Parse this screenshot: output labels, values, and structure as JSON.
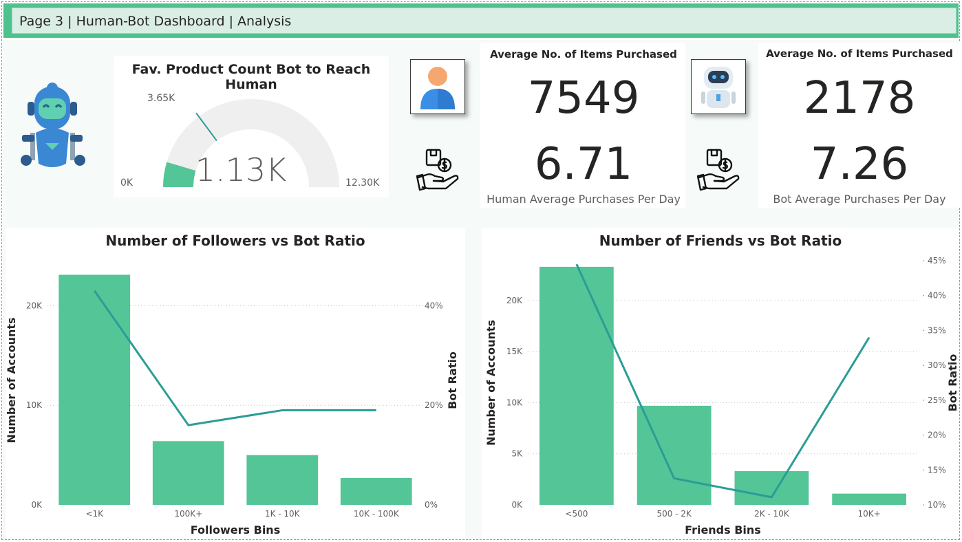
{
  "page": {
    "title": "Page 3 | Human-Bot Dashboard | Analysis",
    "colors": {
      "accent": "#4ec28e",
      "bar": "#54c596",
      "line": "#2a9d96",
      "title_bg": "#daeee6"
    }
  },
  "gauge": {
    "title": "Fav. Product Count Bot to Reach Human",
    "value_label": "1.13K",
    "min_label": "0K",
    "max_label": "12.30K",
    "target_label": "3.65K",
    "value": 1130,
    "min": 0,
    "max": 12300,
    "target": 3650
  },
  "icons": {
    "robot_tile": "robot-icon",
    "human": "person-icon",
    "bot": "bot-face-icon",
    "purchase": "hand-money-box-icon"
  },
  "human_kpi": {
    "top_label": "Average No. of Items Purchased",
    "items_value": "7549",
    "purchases_value": "6.71",
    "purchases_label": "Human Average Purchases Per Day"
  },
  "bot_kpi": {
    "top_label": "Average No. of Items Purchased",
    "items_value": "2178",
    "purchases_value": "7.26",
    "purchases_label": "Bot Average Purchases Per Day"
  },
  "chart_data": [
    {
      "type": "bar",
      "title": "Number of Followers vs Bot Ratio",
      "xlabel": "Followers Bins",
      "ylabel": "Number of Accounts",
      "y2label": "Bot Ratio",
      "categories": [
        "<1K",
        "100K+",
        "1K - 10K",
        "10K - 100K"
      ],
      "series": [
        {
          "name": "Number of Accounts",
          "kind": "bar",
          "values": [
            23100,
            6400,
            5000,
            2700
          ]
        },
        {
          "name": "Bot Ratio",
          "kind": "line",
          "axis": "y2",
          "values": [
            0.43,
            0.16,
            0.19,
            0.19
          ]
        }
      ],
      "yticks": [
        "0K",
        "10K",
        "20K"
      ],
      "ytick_values": [
        0,
        10000,
        20000
      ],
      "ylim": [
        0,
        25000
      ],
      "y2ticks": [
        "0%",
        "20%",
        "40%"
      ],
      "y2tick_values": [
        0,
        0.2,
        0.4
      ],
      "y2lim": [
        0,
        0.5
      ],
      "grid": true
    },
    {
      "type": "bar",
      "title": "Number of Friends vs Bot Ratio",
      "xlabel": "Friends Bins",
      "ylabel": "Number of Accounts",
      "y2label": "Bot Ratio",
      "categories": [
        "<500",
        "500 - 2K",
        "2K - 10K",
        "10K+"
      ],
      "series": [
        {
          "name": "Number of Accounts",
          "kind": "bar",
          "values": [
            23300,
            9700,
            3300,
            1100
          ]
        },
        {
          "name": "Bot Ratio",
          "kind": "line",
          "axis": "y2",
          "values": [
            0.445,
            0.138,
            0.111,
            0.34
          ]
        }
      ],
      "yticks": [
        "0K",
        "5K",
        "10K",
        "15K",
        "20K"
      ],
      "ytick_values": [
        0,
        5000,
        10000,
        15000,
        20000
      ],
      "ylim": [
        0,
        23900
      ],
      "y2ticks": [
        "10%",
        "15%",
        "20%",
        "25%",
        "30%",
        "35%",
        "40%",
        "45%"
      ],
      "y2tick_values": [
        0.1,
        0.15,
        0.2,
        0.25,
        0.3,
        0.35,
        0.4,
        0.45
      ],
      "y2lim": [
        0.1,
        0.45
      ],
      "grid": true
    }
  ]
}
